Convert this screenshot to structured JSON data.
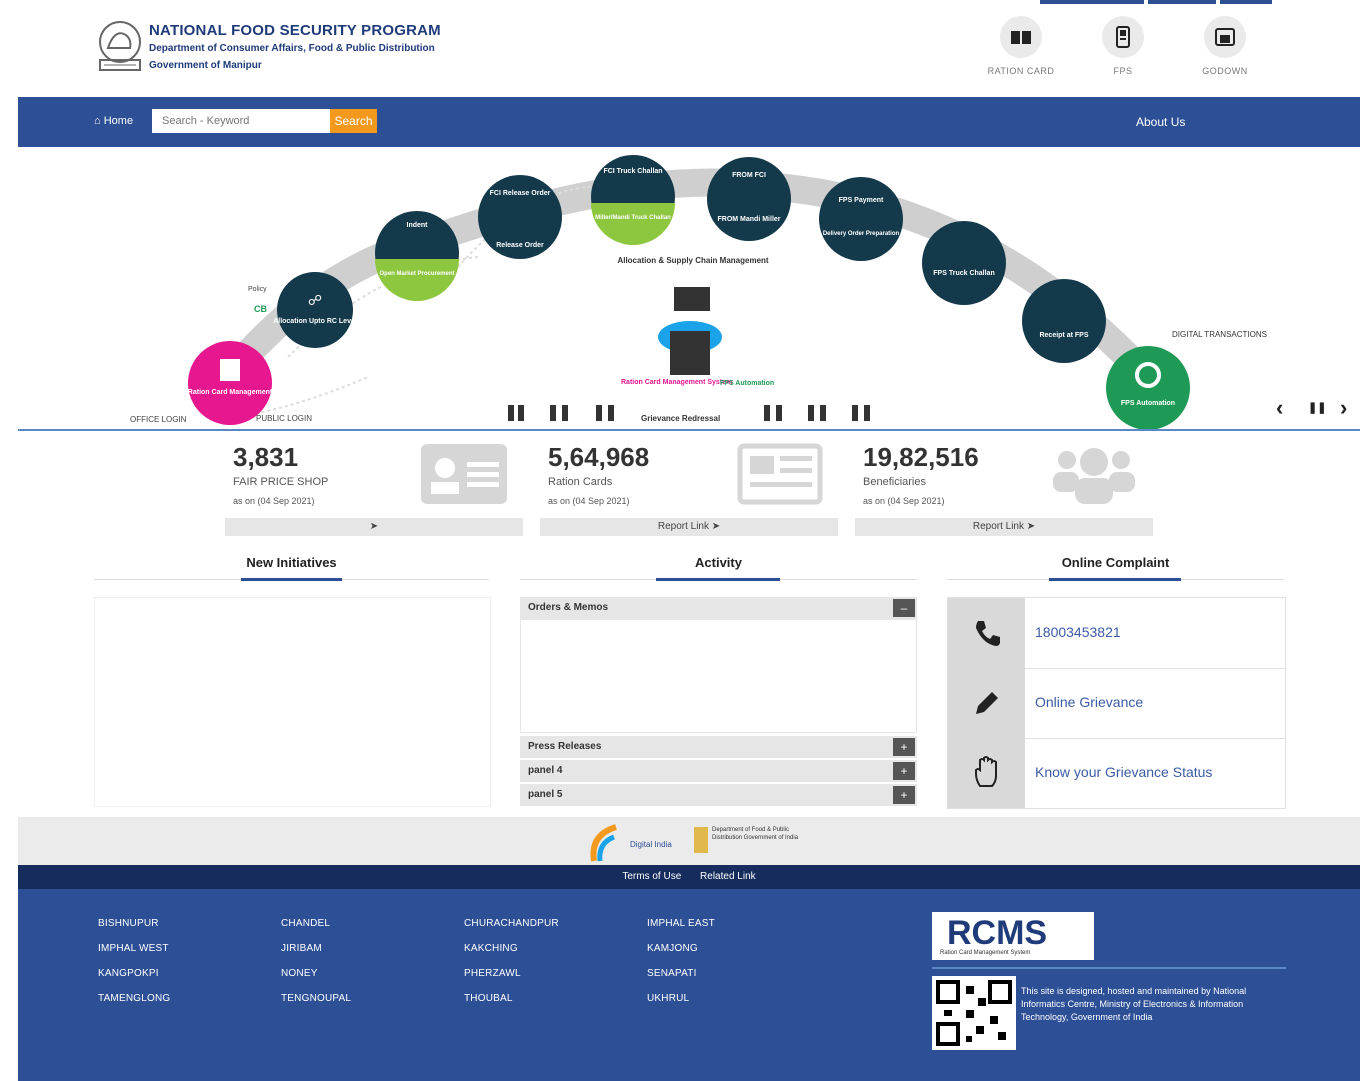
{
  "header": {
    "title": "NATIONAL FOOD SECURITY PROGRAM",
    "subtitle": "Department of Consumer Affairs, Food & Public Distribution",
    "subtitle2": "Government of Manipur",
    "icons": [
      {
        "label": "RATION CARD",
        "icon": "ration-card-icon"
      },
      {
        "label": "FPS",
        "icon": "fps-icon"
      },
      {
        "label": "GODOWN",
        "icon": "godown-icon"
      }
    ]
  },
  "nav": {
    "home": "Home",
    "search_placeholder": "Search - Keyword",
    "search_button": "Search",
    "about": "About Us"
  },
  "banner": {
    "nodes": [
      "Ration Card Management",
      "Allocation Upto RC Level",
      "Indent",
      "Open Market Procurement",
      "FCI Release Order",
      "Release Order",
      "FCI Truck Challan",
      "Miller/Mandi Truck Challan",
      "FROM FCI",
      "FROM Mandi Miller",
      "FPS Payment",
      "Delivery Order Preparation",
      "FPS Truck Challan",
      "Receipt at FPS",
      "FPS Automation"
    ],
    "labels": {
      "policy": "Policy",
      "cb": "CB",
      "office_login": "OFFICE LOGIN",
      "public_login": "PUBLIC LOGIN",
      "supply_chain": "Allocation & Supply Chain Management",
      "rcms": "Ration Card Management System",
      "fps_auto": "FPS Automation",
      "grievance": "Grievance Redressal",
      "digital": "DIGITAL TRANSACTIONS"
    },
    "controls": {
      "prev": "‹",
      "pause": "❚❚",
      "next": "›"
    }
  },
  "stats": [
    {
      "value": "3,831",
      "label": "FAIR PRICE SHOP",
      "date": "as on (04 Sep 2021)",
      "link": "",
      "icon": "id-card-icon"
    },
    {
      "value": "5,64,968",
      "label": "Ration Cards",
      "date": "as on (04 Sep 2021)",
      "link": "Report Link",
      "icon": "newspaper-icon"
    },
    {
      "value": "19,82,516",
      "label": "Beneficiaries",
      "date": "as on (04 Sep 2021)",
      "link": "Report Link",
      "icon": "users-icon"
    }
  ],
  "sections": {
    "new_initiatives": "New Initiatives",
    "activity": "Activity",
    "online_complaint": "Online Complaint"
  },
  "activity_panels": [
    {
      "label": "Orders & Memos",
      "toggle": "–"
    },
    {
      "label": "Press Releases",
      "toggle": "+"
    },
    {
      "label": "panel 4",
      "toggle": "+"
    },
    {
      "label": "panel 5",
      "toggle": "+"
    }
  ],
  "complaint": [
    {
      "text": "18003453821",
      "icon": "phone-icon"
    },
    {
      "text": "Online Grievance",
      "icon": "pencil-icon"
    },
    {
      "text": "Know your Grievance Status",
      "icon": "hand-icon"
    }
  ],
  "footer": {
    "digital_india": "Digital India",
    "dept": "Department of Food & Public Distribution Government of India",
    "terms": "Terms of Use",
    "related": "Related Link",
    "districts": [
      [
        "BISHNUPUR",
        "CHANDEL",
        "CHURACHANDPUR",
        "IMPHAL EAST"
      ],
      [
        "IMPHAL WEST",
        "JIRIBAM",
        "KAKCHING",
        "KAMJONG"
      ],
      [
        "KANGPOKPI",
        "NONEY",
        "PHERZAWL",
        "SENAPATI"
      ],
      [
        "TAMENGLONG",
        "TENGNOUPAL",
        "THOUBAL",
        "UKHRUL"
      ]
    ],
    "rcms": "RCMS",
    "rcms_sub": "Ration Card Management System",
    "note": "This site is designed, hosted and maintained by National Informatics Centre, Ministry of Electronics & Information Technology, Government of India"
  },
  "colors": {
    "navy": "#2d4f96",
    "dark_navy": "#152c5c",
    "teal": "#13394a",
    "green": "#1f9a56",
    "magenta": "#e6178f",
    "orange": "#f39a1e"
  }
}
